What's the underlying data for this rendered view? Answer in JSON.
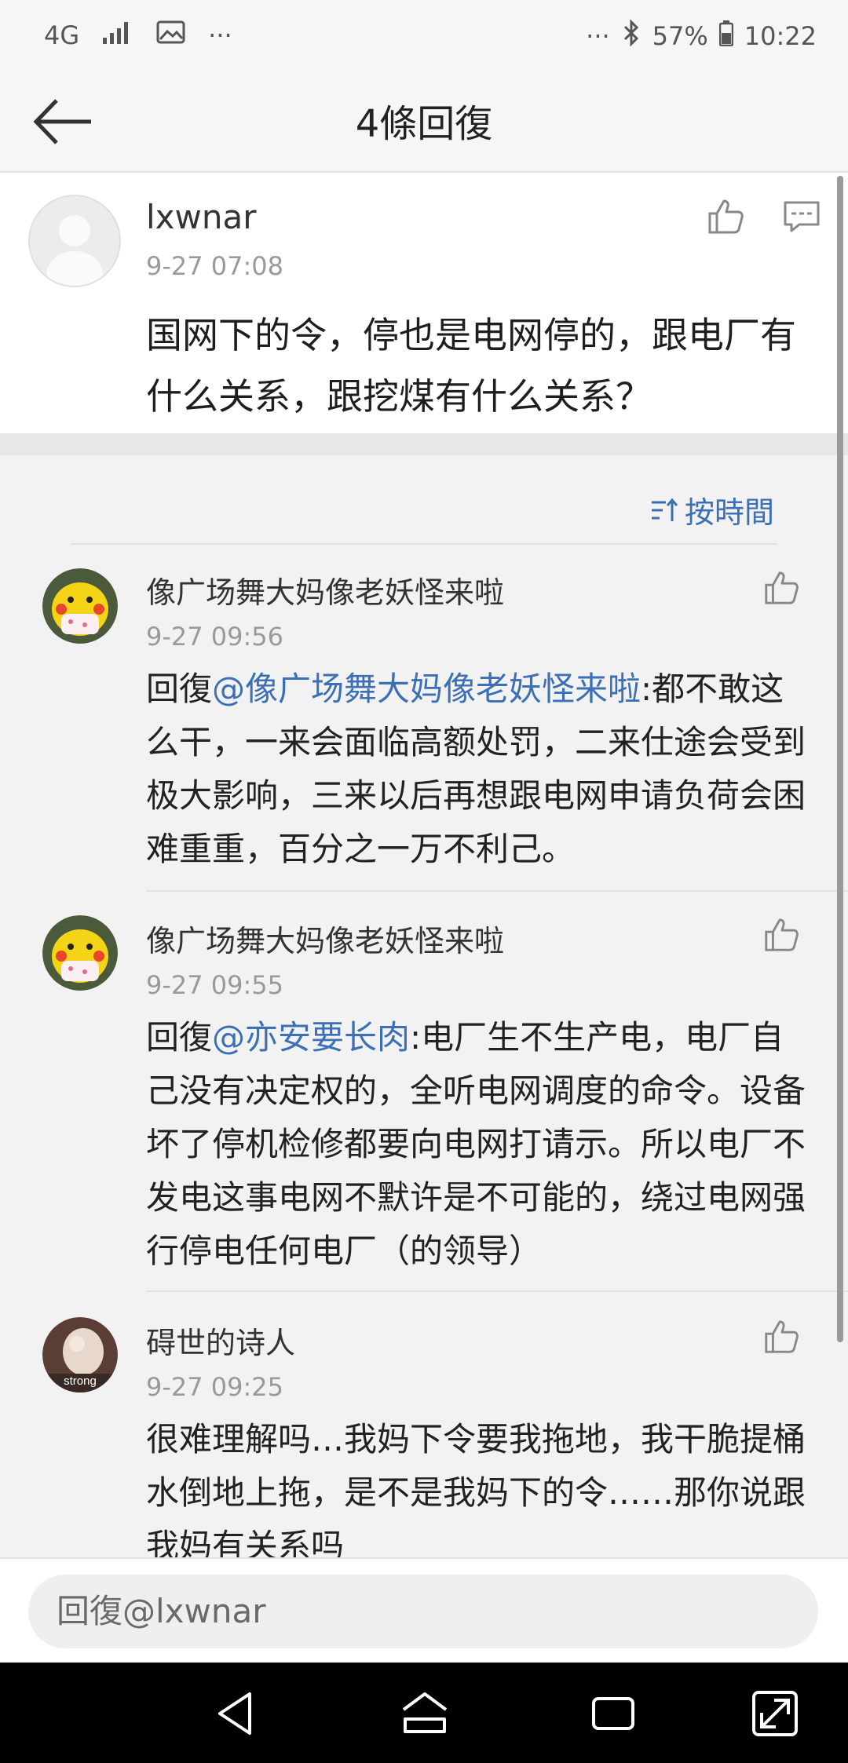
{
  "status_bar": {
    "network": "4G",
    "more_dots": "···",
    "right_dots": "···",
    "battery": "57%",
    "time": "10:22"
  },
  "header": {
    "title": "4條回復"
  },
  "main_post": {
    "user": "lxwnar",
    "time": "9-27 07:08",
    "text": "国网下的令，停也是电网停的，跟电厂有什么关系，跟挖煤有什么关系？"
  },
  "sort": {
    "label": "按時間"
  },
  "replies": [
    {
      "user": "像广场舞大妈像老妖怪来啦",
      "time": "9-27 09:56",
      "prefix": "回復",
      "mention": "@像广场舞大妈像老妖怪来啦",
      "text": ":都不敢这么干，一来会面临高额处罚，二来仕途会受到极大影响，三来以后再想跟电网申请负荷会困难重重，百分之一万不利己。"
    },
    {
      "user": "像广场舞大妈像老妖怪来啦",
      "time": "9-27 09:55",
      "prefix": "回復",
      "mention": "@亦安要长肉",
      "text": ":电厂生不生产电，电厂自己没有决定权的，全听电网调度的命令。设备坏了停机检修都要向电网打请示。所以电厂不发电这事电网不默许是不可能的，绕过电网强行停电任何电厂（的领导）"
    },
    {
      "user": "碍世的诗人",
      "time": "9-27 09:25",
      "text": "很难理解吗…我妈下令要我拖地，我干脆提桶水倒地上拖，是不是我妈下的令……那你说跟我妈有关系吗",
      "avatar_caption": "strong"
    }
  ],
  "composer": {
    "placeholder": "回復@lxwnar"
  },
  "colors": {
    "accent": "#3b6fb6",
    "background": "#f2f2f2",
    "card": "#ffffff"
  }
}
